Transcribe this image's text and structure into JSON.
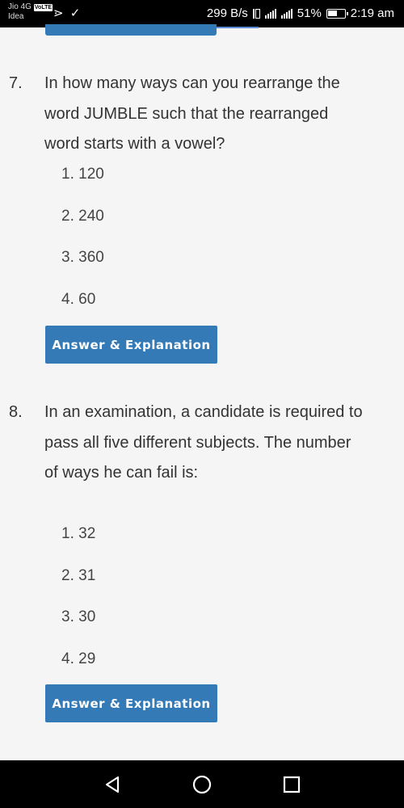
{
  "status_bar": {
    "carrier_1": "Jio 4G",
    "volte": "VoLTE",
    "carrier_2": "Idea",
    "notif_icons": "⋗ ✓",
    "speed": "299 B/s",
    "battery_pct": "51%",
    "time": "2:19 am"
  },
  "questions": [
    {
      "number": "7.",
      "text": "In how many ways can you rearrange the word JUMBLE such that the rearranged word starts with a vowel?",
      "options": [
        "1. 120",
        "2. 240",
        "3. 360",
        "4. 60"
      ],
      "button_label": "Answer & Explanation"
    },
    {
      "number": "8.",
      "text": "In an examination, a candidate is required to pass all five different subjects. The number of ways he can fail is:",
      "options": [
        "1. 32",
        "2. 31",
        "3. 30",
        "4. 29"
      ],
      "button_label": "Answer & Explanation"
    }
  ],
  "nav_bar": {
    "back_icon": "back-triangle-icon",
    "home_icon": "home-circle-icon",
    "recents_icon": "recents-square-icon"
  }
}
